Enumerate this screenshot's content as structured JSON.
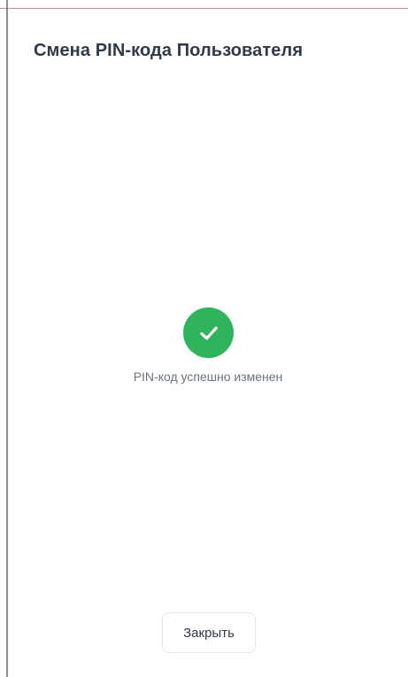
{
  "dialog": {
    "title": "Смена PIN-кода Пользователя",
    "message": "PIN-код успешно изменен",
    "close_label": "Закрыть",
    "status_icon": "check-circle-icon"
  },
  "colors": {
    "success": "#2fb35b",
    "title_text": "#2f3b4c",
    "message_text": "#6b7280",
    "button_border": "#e3e6ea"
  }
}
